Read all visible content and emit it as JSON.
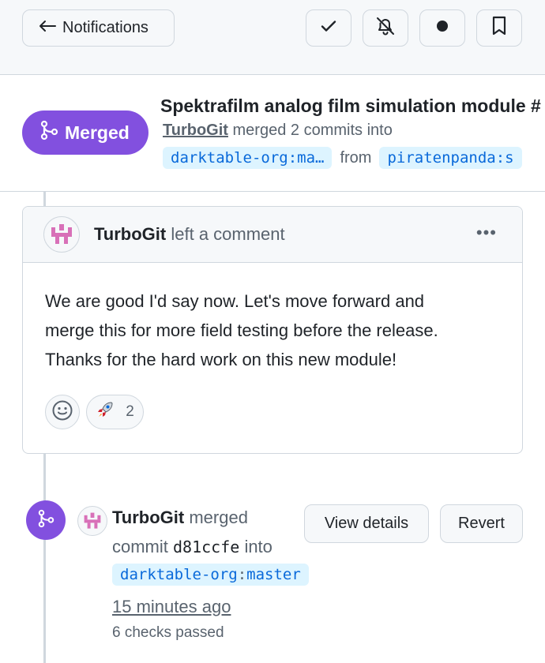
{
  "topbar": {
    "back_label": "Notifications",
    "back_icon": "arrow-left-icon",
    "actions": [
      "check-icon",
      "bell-slash-icon",
      "dot-icon",
      "bookmark-icon"
    ]
  },
  "pr": {
    "status": "Merged",
    "title": "Spektrafilm analog film simulation module  #",
    "author": "TurboGit",
    "merged_text": "merged 2 commits into",
    "base_branch": "darktable-org:ma…",
    "from_text": "from",
    "head_branch": "piratenpanda:s"
  },
  "comment": {
    "author": "TurboGit",
    "action": "left a comment",
    "body_lines": [
      "We are good I'd say now. Let's move forward and",
      "merge this for more field testing before the release.",
      "Thanks for the hard work on this new module!"
    ],
    "reaction_count": "2",
    "reaction_icon": "rocket-icon"
  },
  "merge_event": {
    "author": "TurboGit",
    "action": "merged",
    "commit_prefix": "commit",
    "sha": "d81ccfe",
    "into": "into",
    "branch_owner": "darktable-org",
    "branch_name": "master",
    "time": "15 minutes ago",
    "checks": "6 checks passed",
    "view_details_label": "View details",
    "revert_label": "Revert"
  },
  "colors": {
    "merged_purple": "#8250df",
    "link_blue": "#0969da",
    "branch_bg": "#ddf4ff",
    "avatar_pink": "#d870b8"
  }
}
